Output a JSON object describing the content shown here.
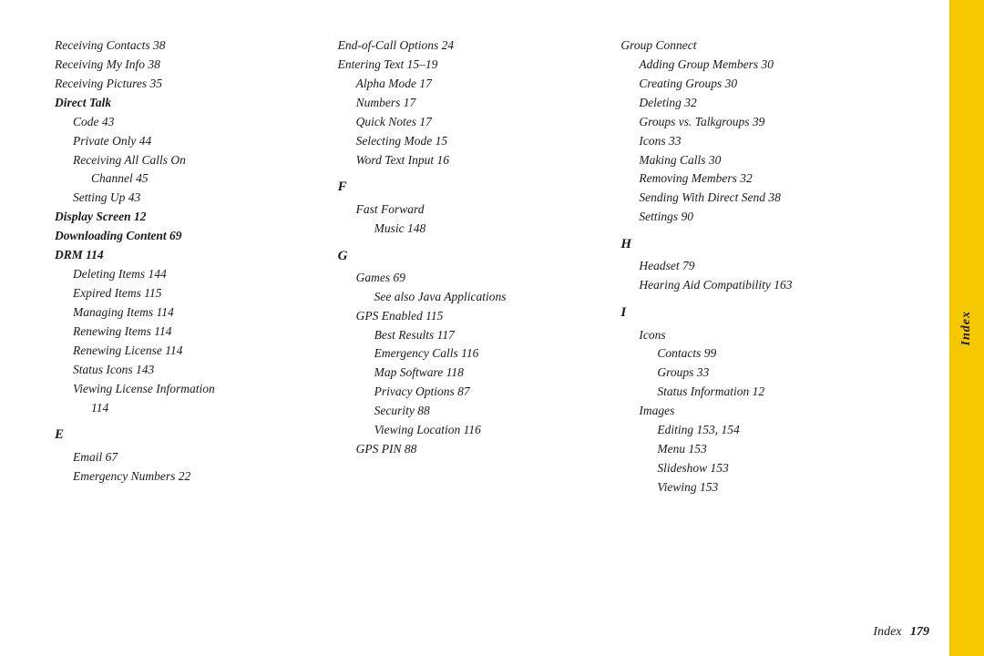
{
  "sideTab": "Index",
  "footer": {
    "label": "Index",
    "number": "179"
  },
  "col1": [
    {
      "text": "Receiving Contacts 38",
      "style": "italic-only"
    },
    {
      "text": "Receiving My Info 38",
      "style": "italic-only"
    },
    {
      "text": "Receiving Pictures 35",
      "style": "italic-only"
    },
    {
      "text": "Direct Talk",
      "style": "bold-italic"
    },
    {
      "text": "Code 43",
      "style": "italic-only",
      "indent": 1
    },
    {
      "text": "Private Only 44",
      "style": "italic-only",
      "indent": 1
    },
    {
      "text": "Receiving All Calls On",
      "style": "italic-only",
      "indent": 1
    },
    {
      "text": "Channel 45",
      "style": "italic-only",
      "indent": 2
    },
    {
      "text": "Setting Up 43",
      "style": "italic-only",
      "indent": 1
    },
    {
      "text": "Display Screen 12",
      "style": "bold-italic"
    },
    {
      "text": "Downloading Content 69",
      "style": "bold-italic"
    },
    {
      "text": "DRM 114",
      "style": "bold-italic"
    },
    {
      "text": "Deleting Items 144",
      "style": "italic-only",
      "indent": 1
    },
    {
      "text": "Expired Items 115",
      "style": "italic-only",
      "indent": 1
    },
    {
      "text": "Managing Items 114",
      "style": "italic-only",
      "indent": 1
    },
    {
      "text": "Renewing Items 114",
      "style": "italic-only",
      "indent": 1
    },
    {
      "text": "Renewing License 114",
      "style": "italic-only",
      "indent": 1
    },
    {
      "text": "Status Icons 143",
      "style": "italic-only",
      "indent": 1
    },
    {
      "text": "Viewing License Information",
      "style": "italic-only",
      "indent": 1
    },
    {
      "text": "114",
      "style": "italic-only",
      "indent": 2
    },
    {
      "text": "E",
      "style": "section-letter"
    },
    {
      "text": "Email 67",
      "style": "italic-only",
      "indent": 1
    },
    {
      "text": "Emergency Numbers 22",
      "style": "italic-only",
      "indent": 1
    }
  ],
  "col2": [
    {
      "text": "End-of-Call Options 24",
      "style": "italic-only"
    },
    {
      "text": "Entering Text 15–19",
      "style": "italic-only"
    },
    {
      "text": "Alpha Mode 17",
      "style": "italic-only",
      "indent": 1
    },
    {
      "text": "Numbers 17",
      "style": "italic-only",
      "indent": 1
    },
    {
      "text": "Quick Notes 17",
      "style": "italic-only",
      "indent": 1
    },
    {
      "text": "Selecting Mode 15",
      "style": "italic-only",
      "indent": 1
    },
    {
      "text": "Word Text Input 16",
      "style": "italic-only",
      "indent": 1
    },
    {
      "text": "F",
      "style": "section-letter"
    },
    {
      "text": "Fast Forward",
      "style": "italic-only",
      "indent": 1
    },
    {
      "text": "Music 148",
      "style": "italic-only",
      "indent": 2
    },
    {
      "text": "G",
      "style": "section-letter"
    },
    {
      "text": "Games 69",
      "style": "italic-only",
      "indent": 1
    },
    {
      "text": "See also Java Applications",
      "style": "italic-only",
      "indent": 2
    },
    {
      "text": "GPS Enabled 115",
      "style": "italic-only",
      "indent": 1
    },
    {
      "text": "Best Results 117",
      "style": "italic-only",
      "indent": 2
    },
    {
      "text": "Emergency Calls 116",
      "style": "italic-only",
      "indent": 2
    },
    {
      "text": "Map Software 118",
      "style": "italic-only",
      "indent": 2
    },
    {
      "text": "Privacy Options 87",
      "style": "italic-only",
      "indent": 2
    },
    {
      "text": "Security 88",
      "style": "italic-only",
      "indent": 2
    },
    {
      "text": "Viewing Location 116",
      "style": "italic-only",
      "indent": 2
    },
    {
      "text": "GPS PIN 88",
      "style": "italic-only",
      "indent": 1
    }
  ],
  "col3": [
    {
      "text": "Group Connect",
      "style": "italic-only"
    },
    {
      "text": "Adding Group Members 30",
      "style": "italic-only",
      "indent": 1
    },
    {
      "text": "Creating Groups 30",
      "style": "italic-only",
      "indent": 1
    },
    {
      "text": "Deleting 32",
      "style": "italic-only",
      "indent": 1
    },
    {
      "text": "Groups vs. Talkgroups 39",
      "style": "italic-only",
      "indent": 1
    },
    {
      "text": "Icons 33",
      "style": "italic-only",
      "indent": 1
    },
    {
      "text": "Making Calls 30",
      "style": "italic-only",
      "indent": 1
    },
    {
      "text": "Removing Members 32",
      "style": "italic-only",
      "indent": 1
    },
    {
      "text": "Sending With Direct Send 38",
      "style": "italic-only",
      "indent": 1
    },
    {
      "text": "Settings 90",
      "style": "italic-only",
      "indent": 1
    },
    {
      "text": "H",
      "style": "section-letter"
    },
    {
      "text": "Headset 79",
      "style": "italic-only",
      "indent": 1
    },
    {
      "text": "Hearing Aid Compatibility 163",
      "style": "italic-only",
      "indent": 1
    },
    {
      "text": "I",
      "style": "section-letter"
    },
    {
      "text": "Icons",
      "style": "italic-only",
      "indent": 1
    },
    {
      "text": "Contacts 99",
      "style": "italic-only",
      "indent": 2
    },
    {
      "text": "Groups 33",
      "style": "italic-only",
      "indent": 2
    },
    {
      "text": "Status Information 12",
      "style": "italic-only",
      "indent": 2
    },
    {
      "text": "Images",
      "style": "italic-only",
      "indent": 1
    },
    {
      "text": "Editing 153, 154",
      "style": "italic-only",
      "indent": 2
    },
    {
      "text": "Menu 153",
      "style": "italic-only",
      "indent": 2
    },
    {
      "text": "Slideshow 153",
      "style": "italic-only",
      "indent": 2
    },
    {
      "text": "Viewing 153",
      "style": "italic-only",
      "indent": 2
    }
  ]
}
